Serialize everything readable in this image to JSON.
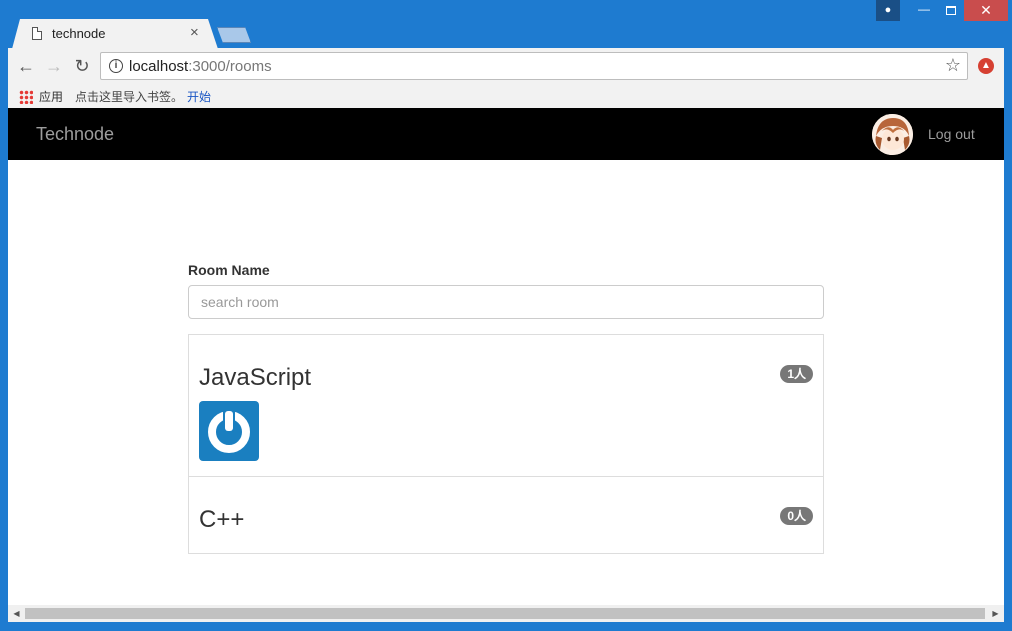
{
  "browser": {
    "tab_title": "technode",
    "tab_close": "×",
    "url_host": "localhost",
    "url_path": ":3000/rooms",
    "back_glyph": "←",
    "forward_glyph": "→",
    "reload_glyph": "↻",
    "star_glyph": "☆",
    "bookmarks": {
      "apps_label": "应用",
      "hint": "点击这里导入书签。",
      "link": "开始"
    },
    "icons": [
      "page-icon",
      "info-icon",
      "star-icon",
      "apps-icon",
      "extension-icon",
      "user-icon"
    ]
  },
  "app": {
    "brand": "Technode",
    "logout": "Log out",
    "form": {
      "label": "Room Name",
      "search_placeholder": "search room",
      "search_value": ""
    },
    "rooms": [
      {
        "name": "JavaScript",
        "count": "1人"
      },
      {
        "name": "C++",
        "count": "0人"
      }
    ]
  },
  "colors": {
    "chrome_blue": "#1e7bd0",
    "navbar": "#000000",
    "badge": "#777777",
    "power_tile": "#1a7fc0"
  }
}
